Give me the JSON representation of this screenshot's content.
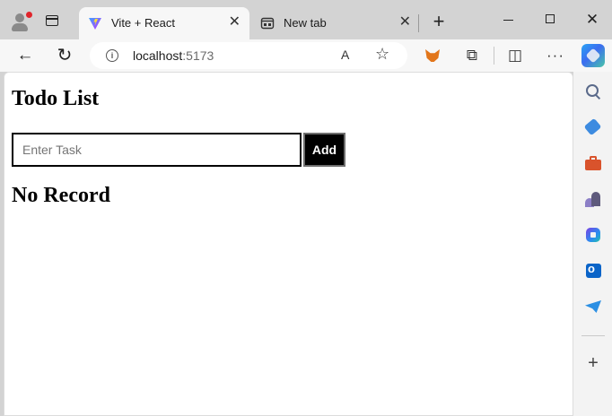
{
  "browser": {
    "tabs": [
      {
        "title": "Vite + React",
        "active": true,
        "close_glyph": "✕"
      },
      {
        "title": "New tab",
        "active": false,
        "close_glyph": "✕"
      }
    ],
    "new_tab_glyph": "+",
    "window_controls": {
      "close_glyph": "✕"
    }
  },
  "toolbar": {
    "back_glyph": "←",
    "refresh_glyph": "↻",
    "url_host": "localhost",
    "url_port": ":5173",
    "info_glyph": "i",
    "read_aloud_glyph": "A",
    "favorite_glyph": "☆",
    "extensions_glyph": "⧉",
    "split_glyph": "◫",
    "more_glyph": "···"
  },
  "page": {
    "heading": "Todo List",
    "task_input": {
      "value": "",
      "placeholder": "Enter Task"
    },
    "add_button_label": "Add",
    "empty_message": "No Record"
  },
  "sidebar": {
    "icons": [
      "search-icon",
      "shopping-tag-icon",
      "tools-icon",
      "games-icon",
      "microsoft-365-icon",
      "outlook-icon",
      "drop-icon"
    ],
    "add_glyph": "+"
  },
  "colors": {
    "chrome_bg": "#d3d3d3",
    "toolbar_bg": "#f7f7f7",
    "page_bg": "#ffffff",
    "button_bg": "#000000",
    "button_text": "#ffffff"
  }
}
